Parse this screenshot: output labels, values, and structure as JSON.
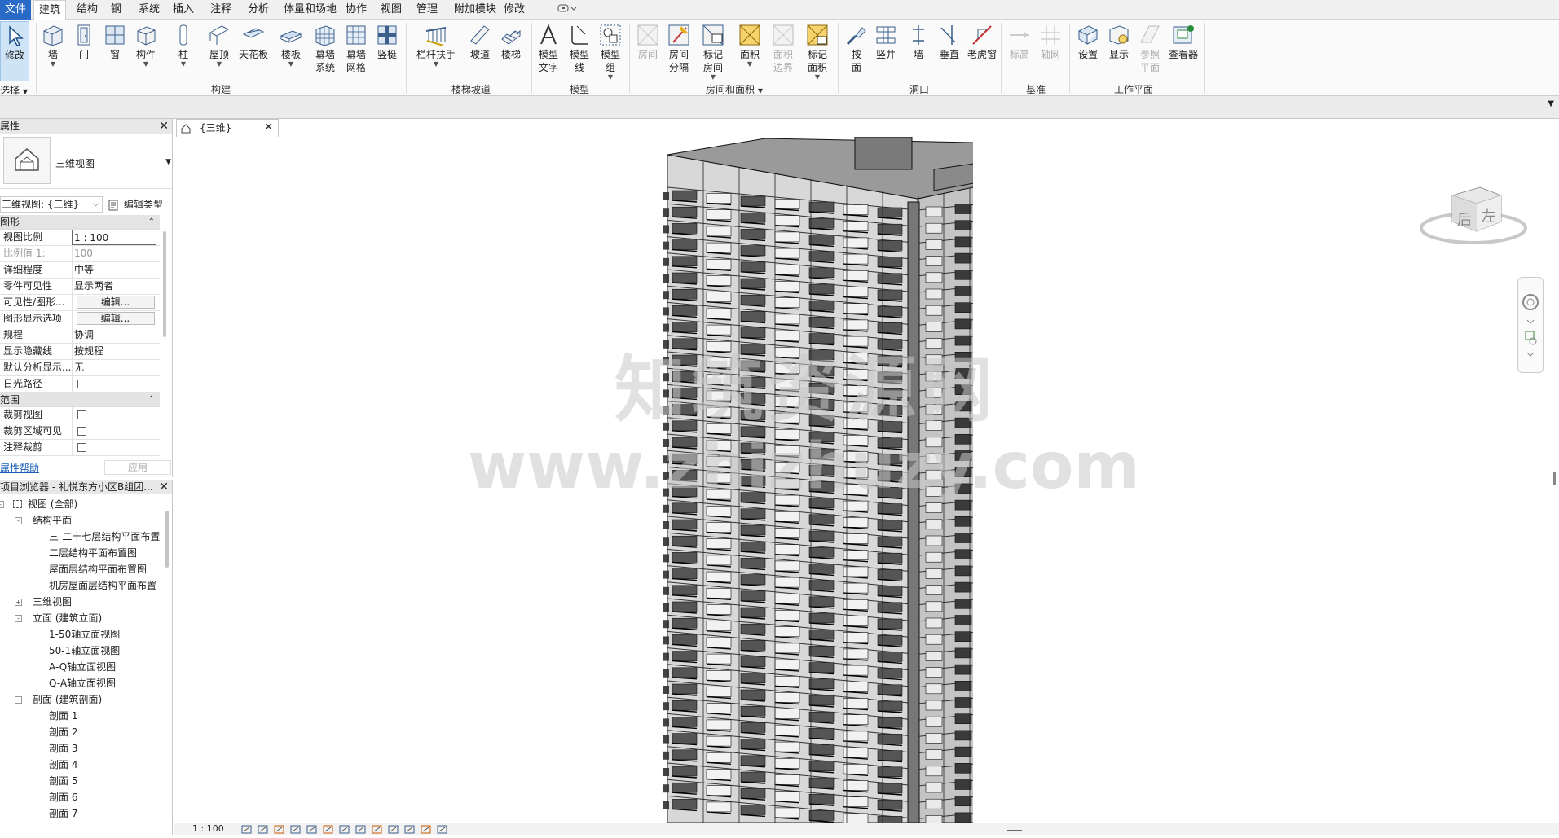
{
  "menu": {
    "file": "文件",
    "tabs": [
      "建筑",
      "结构",
      "钢",
      "系统",
      "插入",
      "注释",
      "分析",
      "体量和场地",
      "协作",
      "视图",
      "管理",
      "附加模块",
      "修改"
    ],
    "active_index": 0
  },
  "ribbon": {
    "buttons": {
      "modify": "修改",
      "wall": "墙",
      "door": "门",
      "window": "窗",
      "component": "构件",
      "column": "柱",
      "roof": "屋顶",
      "ceiling": "天花板",
      "floor": "楼板",
      "curtain_system_1": "幕墙",
      "curtain_system_2": "系统",
      "curtain_grid_1": "幕墙",
      "curtain_grid_2": "网格",
      "mullion": "竖梃",
      "railing": "栏杆扶手",
      "ramp": "坡道",
      "stair": "楼梯",
      "model_text_1": "模型",
      "model_text_2": "文字",
      "model_line_1": "模型",
      "model_line_2": "线",
      "model_group_1": "模型",
      "model_group_2": "组",
      "room": "房间",
      "room_sep_1": "房间",
      "room_sep_2": "分隔",
      "tag_room_1": "标记",
      "tag_room_2": "房间",
      "area": "面积",
      "area_boundary_1": "面积",
      "area_boundary_2": "边界",
      "tag_area_1": "标记",
      "tag_area_2": "面积",
      "by_face_1": "按",
      "by_face_2": "面",
      "shaft": "竖井",
      "opening_wall": "墙",
      "vertical": "垂直",
      "dormer": "老虎窗",
      "level": "标高",
      "grid": "轴网",
      "set": "设置",
      "show": "显示",
      "ref_plane_1": "参照",
      "ref_plane_2": "平面",
      "viewer": "查看器"
    },
    "panels": {
      "select": "选择",
      "build": "构建",
      "circulation": "楼梯坡道",
      "model": "模型",
      "room_area": "房间和面积",
      "opening": "洞口",
      "datum": "基准",
      "workplane": "工作平面"
    }
  },
  "properties": {
    "title": "属性",
    "type_name": "三维视图",
    "selector": "三维视图: {三维}",
    "edit_type": "编辑类型",
    "groups": [
      {
        "name": "图形",
        "rows": [
          {
            "k": "视图比例",
            "v": "1 : 100",
            "kind": "box"
          },
          {
            "k": "比例值 1:",
            "v": "100",
            "kind": "dim"
          },
          {
            "k": "详细程度",
            "v": "中等"
          },
          {
            "k": "零件可见性",
            "v": "显示两者"
          },
          {
            "k": "可见性/图形...",
            "v": "编辑...",
            "kind": "btn"
          },
          {
            "k": "图形显示选项",
            "v": "编辑...",
            "kind": "btn"
          },
          {
            "k": "规程",
            "v": "协调"
          },
          {
            "k": "显示隐藏线",
            "v": "按规程"
          },
          {
            "k": "默认分析显示...",
            "v": "无"
          },
          {
            "k": "日光路径",
            "v": "",
            "kind": "cb"
          }
        ]
      },
      {
        "name": "范围",
        "rows": [
          {
            "k": "裁剪视图",
            "v": "",
            "kind": "cb"
          },
          {
            "k": "裁剪区域可见",
            "v": "",
            "kind": "cb"
          },
          {
            "k": "注释裁剪",
            "v": "",
            "kind": "cb"
          }
        ]
      }
    ],
    "help": "属性帮助",
    "apply": "应用"
  },
  "browser": {
    "title": "项目浏览器 - 礼悦东方小区B组团...",
    "nodes": [
      {
        "label": "视图 (全部)",
        "level": 0,
        "toggle": "-",
        "icon": true
      },
      {
        "label": "结构平面",
        "level": 1,
        "toggle": "-"
      },
      {
        "label": "三-二十七层结构平面布置",
        "level": 2
      },
      {
        "label": "二层结构平面布置图",
        "level": 2
      },
      {
        "label": "屋面层结构平面布置图",
        "level": 2
      },
      {
        "label": "机房屋面层结构平面布置",
        "level": 2
      },
      {
        "label": "三维视图",
        "level": 1,
        "toggle": "+"
      },
      {
        "label": "立面 (建筑立面)",
        "level": 1,
        "toggle": "-"
      },
      {
        "label": "1-50轴立面视图",
        "level": 2
      },
      {
        "label": "50-1轴立面视图",
        "level": 2
      },
      {
        "label": "A-Q轴立面视图",
        "level": 2
      },
      {
        "label": "Q-A轴立面视图",
        "level": 2
      },
      {
        "label": "剖面 (建筑剖面)",
        "level": 1,
        "toggle": "-"
      },
      {
        "label": "剖面 1",
        "level": 2
      },
      {
        "label": "剖面 2",
        "level": 2
      },
      {
        "label": "剖面 3",
        "level": 2
      },
      {
        "label": "剖面 4",
        "level": 2
      },
      {
        "label": "剖面 5",
        "level": 2
      },
      {
        "label": "剖面 6",
        "level": 2
      },
      {
        "label": "剖面 7",
        "level": 2
      }
    ]
  },
  "view_tab": {
    "label": "{三维}"
  },
  "viewcube": {
    "face_back": "后",
    "face_left": "左"
  },
  "status": {
    "scale": "1 : 100"
  },
  "watermark": {
    "line1": "知筑资源网",
    "line2": "www.zhizhuzy.com"
  }
}
